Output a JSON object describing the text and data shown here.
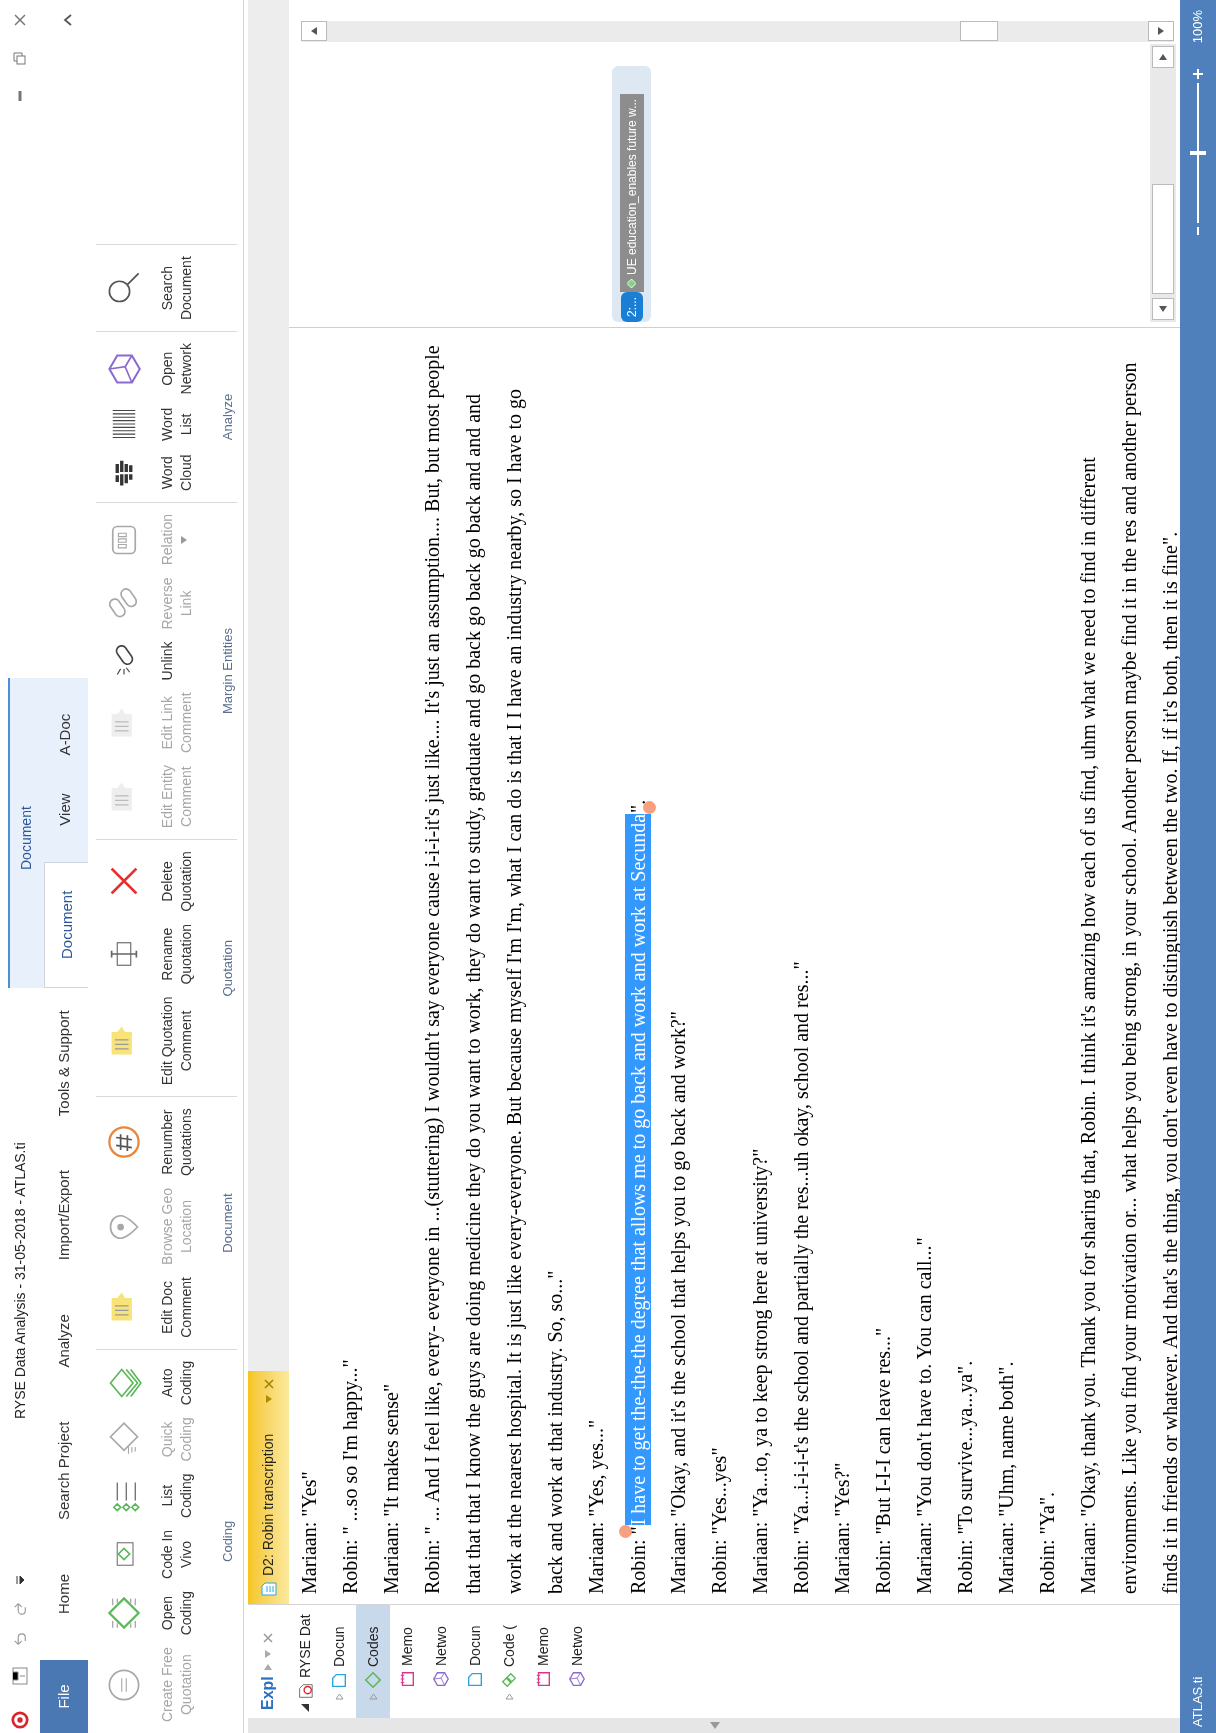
{
  "title_bar": {
    "title": "RYSE Data Analysis - 31-05-2018 - ATLAS.ti",
    "context_group": "Document"
  },
  "menu_tabs": [
    {
      "label": "File",
      "kind": "file",
      "selected": false
    },
    {
      "label": "Home",
      "kind": "plain",
      "selected": false
    },
    {
      "label": "Search Project",
      "kind": "plain",
      "selected": false
    },
    {
      "label": "Analyze",
      "kind": "plain",
      "selected": false
    },
    {
      "label": "Import/Export",
      "kind": "plain",
      "selected": false
    },
    {
      "label": "Tools & Support",
      "kind": "plain",
      "selected": false
    },
    {
      "label": "Document",
      "kind": "contextual",
      "selected": true
    },
    {
      "label": "View",
      "kind": "contextual",
      "selected": false
    },
    {
      "label": "A-Doc",
      "kind": "contextual",
      "selected": false
    }
  ],
  "ribbon": [
    {
      "label": "Coding",
      "buttons": [
        {
          "label": "Create Free\nQuotation",
          "disabled": true
        },
        {
          "label": "Open\nCoding",
          "disabled": false
        },
        {
          "label": "Code In\nVivo",
          "disabled": false
        },
        {
          "label": "List\nCoding",
          "disabled": false
        },
        {
          "label": "Quick\nCoding",
          "disabled": true
        },
        {
          "label": "Auto\nCoding",
          "disabled": false
        }
      ]
    },
    {
      "label": "Document",
      "buttons": [
        {
          "label": "Edit Doc\nComment",
          "disabled": false
        },
        {
          "label": "Browse Geo\nLocation",
          "disabled": true
        },
        {
          "label": "Renumber\nQuotations",
          "disabled": false
        }
      ]
    },
    {
      "label": "Quotation",
      "buttons": [
        {
          "label": "Edit Quotation\nComment",
          "disabled": false
        },
        {
          "label": "Rename\nQuotation",
          "disabled": false
        },
        {
          "label": "Delete\nQuotation",
          "disabled": false
        }
      ]
    },
    {
      "label": "Margin Entities",
      "buttons": [
        {
          "label": "Edit Entity\nComment",
          "disabled": true
        },
        {
          "label": "Edit Link\nComment",
          "disabled": true
        },
        {
          "label": "Unlink",
          "disabled": false
        },
        {
          "label": "Reverse\nLink",
          "disabled": true
        },
        {
          "label": "Relation",
          "disabled": true,
          "dropdown": true
        }
      ]
    },
    {
      "label": "Analyze",
      "buttons": [
        {
          "label": "Word\nCloud",
          "disabled": false
        },
        {
          "label": "Word\nList",
          "disabled": false
        },
        {
          "label": "Open\nNetwork",
          "disabled": false
        }
      ]
    },
    {
      "buttons": [
        {
          "label": "Search\nDocument",
          "disabled": false
        }
      ]
    }
  ],
  "explorer": {
    "title": "Expl",
    "tree": [
      {
        "label": "RYSE Dat",
        "kind": "project",
        "expanded": true,
        "selected": false,
        "children": [
          {
            "label": "Docun",
            "kind": "document",
            "expanded": false,
            "selected": false
          },
          {
            "label": "Codes",
            "kind": "code",
            "expanded": false,
            "selected": true
          },
          {
            "label": "Memo",
            "kind": "memo",
            "selected": false
          },
          {
            "label": "Netwo",
            "kind": "network",
            "selected": false
          },
          {
            "label": "Docun",
            "kind": "document",
            "selected": false
          },
          {
            "label": "Code (",
            "kind": "code-group",
            "expanded": false,
            "selected": false
          },
          {
            "label": "Memo",
            "kind": "memo",
            "selected": false
          },
          {
            "label": "Netwo",
            "kind": "network",
            "selected": false
          }
        ]
      }
    ]
  },
  "document_tab": {
    "label": "D2: Robin transcription"
  },
  "transcript": [
    {
      "kind": "plain",
      "lines": [
        "Mariaan: \"Yes\""
      ]
    },
    {
      "kind": "plain",
      "lines": [
        "Robin: \" ...so so I'm happy...\""
      ]
    },
    {
      "kind": "plain",
      "lines": [
        "Mariaan: \"It makes sense\""
      ]
    },
    {
      "kind": "plain",
      "lines": [
        "Robin: \" ... And I feel like, every- everyone in ...(stuttering) I wouldn't say everyone cause i-i-i-it's just like.... It's just an assumption.... But, but most people",
        "that that that I know the guys are doing medicine they do you want to work, they do want to study, graduate and go back go back go back and and and",
        "work at the nearest hospital. It is just like every-everyone. But because myself I'm I'm, what I can do is that I I have an industry nearby, so I have to go",
        "back and work at that industry. So, so...\""
      ]
    },
    {
      "kind": "plain",
      "lines": [
        "Mariaan: \"Yes, yes...\""
      ]
    },
    {
      "kind": "quoted",
      "before": "Robin: \"",
      "quotation": {
        "text": "I have to get the-the-the degree that allows me to go back and work and work at Secunda",
        "selected": true
      },
      "after": "\"."
    },
    {
      "kind": "plain",
      "lines": [
        "Mariaan: \"Okay, and it's the school that helps you to go back and work?\""
      ]
    },
    {
      "kind": "plain",
      "lines": [
        "Robin: \"Yes...yes\""
      ]
    },
    {
      "kind": "plain",
      "lines": [
        "Mariaan: \"Ya...to, ya to keep strong here at university?\""
      ]
    },
    {
      "kind": "plain",
      "lines": [
        "Robin: \"Ya...i-i-i-t's the school and partially the res...uh okay, school and res...\""
      ]
    },
    {
      "kind": "plain",
      "lines": [
        "Mariaan: \"Yes?\""
      ]
    },
    {
      "kind": "plain",
      "lines": [
        "Robin: \"But I-I-I can leave res...\""
      ]
    },
    {
      "kind": "plain",
      "lines": [
        "Mariaan: \"You don't have to. You can call...\""
      ]
    },
    {
      "kind": "plain",
      "lines": [
        "Robin: \"To survive...ya...ya\"."
      ]
    },
    {
      "kind": "plain",
      "lines": [
        "Mariaan: \"Uhm, name both\"."
      ]
    },
    {
      "kind": "plain",
      "lines": [
        "Robin: \"Ya\"."
      ]
    },
    {
      "kind": "plain",
      "lines": [
        "Mariaan: \"Okay, thank you. Thank you for sharing that, Robin. I think it's amazing how each of us find, uhm what we need to find in different",
        "environments. Like you find your motivation or... what helps you being strong, in your school. Another person maybe find it in the res and another person",
        "finds it in friends or whatever. And that's the thing, you don't even have to distinguish between the two. If, if it's both, then it is fine\"."
      ]
    }
  ],
  "margin": {
    "badge": "2:...",
    "code": "UE education_enables future w..."
  },
  "status_bar": {
    "app": "ATLAS.ti",
    "zoom": {
      "level": 0.5,
      "reading": "100%"
    }
  }
}
